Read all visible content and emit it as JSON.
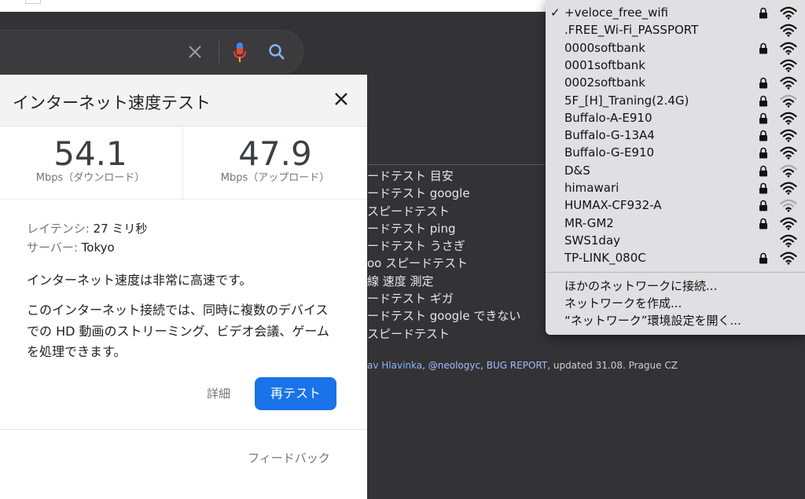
{
  "search": {
    "clear_icon": "close-icon",
    "mic_icon": "mic-icon",
    "search_icon": "search-icon"
  },
  "speed_test": {
    "title": "インターネット速度テスト",
    "download": {
      "value": "54.1",
      "unit": "Mbps（ダウンロード）"
    },
    "upload": {
      "value": "47.9",
      "unit": "Mbps（アップロード）"
    },
    "latency_label": "レイテンシ:",
    "latency_value": "27 ミリ秒",
    "server_label": "サーバー:",
    "server_value": "Tokyo",
    "speed_message": "インターネット速度は非常に高速です。",
    "description_lines": [
      "このインターネット接続では、同時に複数のデバイス",
      "での HD 動画のストリーミング、ビデオ会議、ゲーム",
      "を処理できます。"
    ],
    "detail_label": "詳細",
    "retest_label": "再テスト",
    "feedback_label": "フィードバック"
  },
  "background_page": {
    "suggestions": [
      "ードテスト 目安",
      "ードテスト google",
      " スピードテスト",
      "ードテスト ping",
      "ードテスト うさぎ",
      "oo スピードテスト",
      "線 速度 測定",
      "ードテスト ギガ",
      "ードテスト google できない",
      "スピードテスト"
    ],
    "footer": {
      "link1": "av Hlavinka",
      "sep1": ", ",
      "link2": "@neologyc",
      "sep2": ", ",
      "link3": "BUG REPORT",
      "tail": ", updated 31.08. Prague CZ"
    }
  },
  "wifi_menu": {
    "networks": [
      {
        "name": "+veloce_free_wifi",
        "connected": true,
        "locked": true,
        "signal": 3
      },
      {
        "name": ".FREE_Wi-Fi_PASSPORT",
        "connected": false,
        "locked": false,
        "signal": 3
      },
      {
        "name": "0000softbank",
        "connected": false,
        "locked": true,
        "signal": 3
      },
      {
        "name": "0001softbank",
        "connected": false,
        "locked": false,
        "signal": 3
      },
      {
        "name": "0002softbank",
        "connected": false,
        "locked": true,
        "signal": 3
      },
      {
        "name": "5F_[H]_Traning(2.4G)",
        "connected": false,
        "locked": true,
        "signal": 2
      },
      {
        "name": "Buffalo-A-E910",
        "connected": false,
        "locked": true,
        "signal": 3
      },
      {
        "name": "Buffalo-G-13A4",
        "connected": false,
        "locked": true,
        "signal": 3
      },
      {
        "name": "Buffalo-G-E910",
        "connected": false,
        "locked": true,
        "signal": 3
      },
      {
        "name": "D&S",
        "connected": false,
        "locked": true,
        "signal": 2
      },
      {
        "name": "himawari",
        "connected": false,
        "locked": true,
        "signal": 3
      },
      {
        "name": "HUMAX-CF932-A",
        "connected": false,
        "locked": true,
        "signal": 1
      },
      {
        "name": "MR-GM2",
        "connected": false,
        "locked": true,
        "signal": 3
      },
      {
        "name": "SWS1day",
        "connected": false,
        "locked": false,
        "signal": 3
      },
      {
        "name": "TP-LINK_080C",
        "connected": false,
        "locked": true,
        "signal": 3
      }
    ],
    "check_mark": "✓",
    "actions": [
      "ほかのネットワークに接続...",
      "ネットワークを作成...",
      "“ネットワーク”環境設定を開く..."
    ]
  },
  "colors": {
    "accent": "#1a73e8",
    "background": "#333335",
    "menu": "#e0e0e2"
  }
}
